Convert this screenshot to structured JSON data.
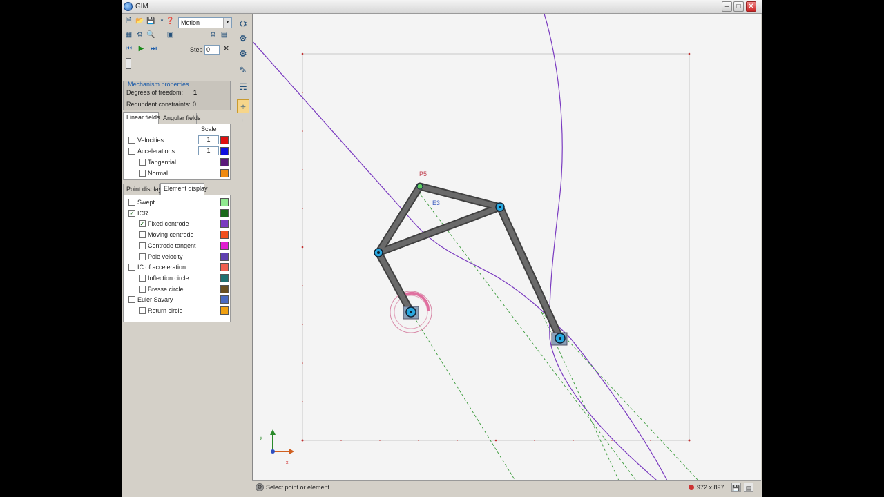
{
  "window": {
    "title": "GIM"
  },
  "toolbar": {
    "mode": "Motion",
    "step_label": "Step",
    "step_value": "0"
  },
  "mechanism": {
    "legend": "Mechanism properties",
    "dof_label": "Degrees of freedom:",
    "dof_value": "1",
    "redundant_label": "Redundant constraints:",
    "redundant_value": "0"
  },
  "field_tabs": [
    "Linear fields",
    "Angular fields"
  ],
  "fields": {
    "scale_header": "Scale",
    "rows": [
      {
        "label": "Velocities",
        "scale": "1",
        "color": "#e01010",
        "checked": false
      },
      {
        "label": "Accelerations",
        "scale": "1",
        "color": "#1010e0",
        "checked": false
      },
      {
        "label": "Tangential",
        "color": "#5a1a7a",
        "checked": false
      },
      {
        "label": "Normal",
        "color": "#f08a10",
        "checked": false
      }
    ]
  },
  "display_tabs": [
    "Point display",
    "Element display"
  ],
  "element_display": [
    {
      "label": "Swept",
      "color": "#90e890",
      "checked": false,
      "indent": false
    },
    {
      "label": "ICR",
      "color": "#1a6a1a",
      "checked": true,
      "indent": false
    },
    {
      "label": "Fixed centrode",
      "color": "#7a3ac0",
      "checked": true,
      "indent": true
    },
    {
      "label": "Moving centrode",
      "color": "#f05020",
      "checked": false,
      "indent": true
    },
    {
      "label": "Centrode tangent",
      "color": "#e020d0",
      "checked": false,
      "indent": true
    },
    {
      "label": "Pole velocity",
      "color": "#6040b0",
      "checked": false,
      "indent": true
    },
    {
      "label": "IC of acceleration",
      "color": "#f06050",
      "checked": false,
      "indent": false
    },
    {
      "label": "Inflection circle",
      "color": "#207070",
      "checked": false,
      "indent": true
    },
    {
      "label": "Bresse circle",
      "color": "#6a5020",
      "checked": false,
      "indent": true
    },
    {
      "label": "Euler Savary",
      "color": "#4a6ac0",
      "checked": false,
      "indent": false
    },
    {
      "label": "Return circle",
      "color": "#f0a010",
      "checked": false,
      "indent": true
    }
  ],
  "canvas": {
    "point_label": "P5",
    "element_label": "E3",
    "axis_y": "y",
    "axis_x": "x"
  },
  "status": {
    "text": "Select point or element",
    "dims": "972 x 897"
  },
  "icons": [
    "new-icon",
    "open-icon",
    "save-icon",
    "help-icon",
    "grid-icon",
    "gear-icon",
    "zoom-icon",
    "lock-icon",
    "first-frame-icon",
    "play-icon",
    "last-frame-icon",
    "close-icon"
  ]
}
